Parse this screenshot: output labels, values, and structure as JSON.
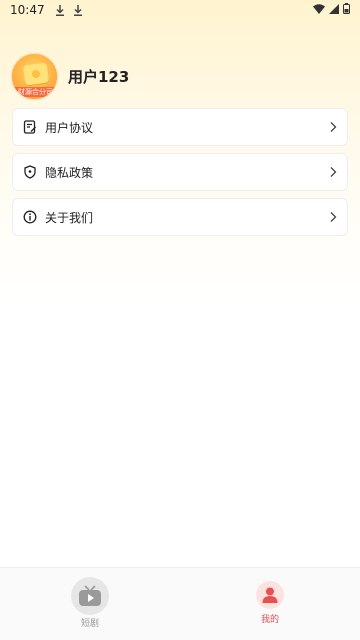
{
  "status_bar": {
    "time": "10:47",
    "left_icons": [
      "download-icon",
      "download-icon"
    ],
    "right_icons": [
      "wifi-icon",
      "signal-icon",
      "battery-icon"
    ]
  },
  "profile": {
    "avatar_caption": "财源合分司",
    "username": "用户123"
  },
  "menu": {
    "items": [
      {
        "label": "用户协议",
        "icon": "agreement-icon"
      },
      {
        "label": "隐私政策",
        "icon": "shield-icon"
      },
      {
        "label": "关于我们",
        "icon": "info-icon"
      }
    ]
  },
  "tabbar": {
    "tabs": [
      {
        "label": "短剧",
        "icon": "tv-play-icon",
        "active": false
      },
      {
        "label": "我的",
        "icon": "user-icon",
        "active": true
      }
    ]
  },
  "colors": {
    "accent": "#e94f4f",
    "header_gradient_top": "#fff3cf",
    "inactive_tab": "#999999"
  }
}
